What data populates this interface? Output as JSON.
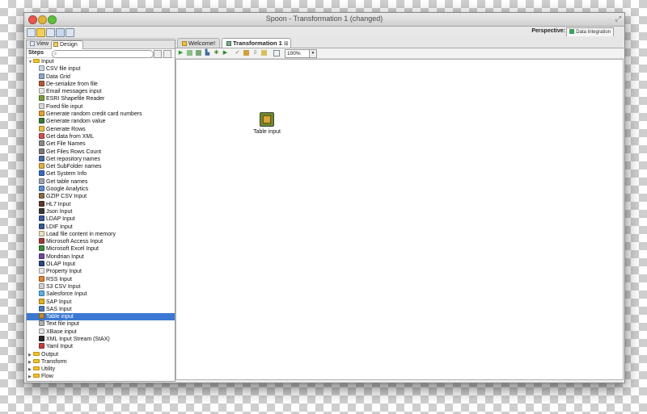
{
  "window": {
    "title": "Spoon - Transformation 1 (changed)"
  },
  "perspective": {
    "label": "Perspective:",
    "value": "Data Integration"
  },
  "left_panel": {
    "tabs": [
      "View",
      "Design"
    ],
    "steps_label": "Steps",
    "search_placeholder": "",
    "categories": [
      {
        "label": "Input",
        "expanded": true,
        "items": [
          {
            "label": "CSV file input",
            "color": "#c9d6e4"
          },
          {
            "label": "Data Grid",
            "color": "#8aa6c2"
          },
          {
            "label": "De-serialize from file",
            "color": "#b05a3a"
          },
          {
            "label": "Email messages input",
            "color": "#e8e8e8"
          },
          {
            "label": "ESRI Shapefile Reader",
            "color": "#7a9c3a"
          },
          {
            "label": "Fixed file input",
            "color": "#d8d8d8"
          },
          {
            "label": "Generate random credit card numbers",
            "color": "#e0a030"
          },
          {
            "label": "Generate random value",
            "color": "#3a7a3a"
          },
          {
            "label": "Generate Rows",
            "color": "#e6c040"
          },
          {
            "label": "Get data from XML",
            "color": "#d05050"
          },
          {
            "label": "Get File Names",
            "color": "#8a8a8a"
          },
          {
            "label": "Get Files Rows Count",
            "color": "#7a7a7a"
          },
          {
            "label": "Get repository names",
            "color": "#4a6aa0"
          },
          {
            "label": "Get SubFolder names",
            "color": "#e0b040"
          },
          {
            "label": "Get System Info",
            "color": "#3a6ac0"
          },
          {
            "label": "Get table names",
            "color": "#9aa4b0"
          },
          {
            "label": "Google Analytics",
            "color": "#5a8ad0"
          },
          {
            "label": "GZIP CSV Input",
            "color": "#8a6a4a"
          },
          {
            "label": "HL7 Input",
            "color": "#5a3a2a"
          },
          {
            "label": "Json Input",
            "color": "#3a3a3a"
          },
          {
            "label": "LDAP Input",
            "color": "#3a5aa0"
          },
          {
            "label": "LDIF Input",
            "color": "#3a5a90"
          },
          {
            "label": "Load file content in memory",
            "color": "#e8e0c0"
          },
          {
            "label": "Microsoft Access Input",
            "color": "#a03a3a"
          },
          {
            "label": "Microsoft Excel Input",
            "color": "#3a8a3a"
          },
          {
            "label": "Mondrian Input",
            "color": "#6a4aa0"
          },
          {
            "label": "OLAP Input",
            "color": "#2a4a7a"
          },
          {
            "label": "Property Input",
            "color": "#e8e8e8"
          },
          {
            "label": "RSS Input",
            "color": "#e08030"
          },
          {
            "label": "S3 CSV Input",
            "color": "#d0d0d0"
          },
          {
            "label": "Salesforce Input",
            "color": "#5ab0e0"
          },
          {
            "label": "SAP Input",
            "color": "#e0b020"
          },
          {
            "label": "SAS Input",
            "color": "#4a7ac0"
          },
          {
            "label": "Table input",
            "color": "#c08a30",
            "selected": true
          },
          {
            "label": "Text file input",
            "color": "#b0b0b0"
          },
          {
            "label": "XBase input",
            "color": "#e0e0e0"
          },
          {
            "label": "XML Input Stream (StAX)",
            "color": "#2a2a2a"
          },
          {
            "label": "Yaml Input",
            "color": "#c04040"
          }
        ]
      },
      {
        "label": "Output",
        "expanded": false
      },
      {
        "label": "Transform",
        "expanded": false
      },
      {
        "label": "Utility",
        "expanded": false
      },
      {
        "label": "Flow",
        "expanded": false
      }
    ]
  },
  "editor": {
    "tabs": [
      {
        "label": "Welcome!",
        "active": false
      },
      {
        "label": "Transformation 1",
        "active": true,
        "close": "⊠"
      }
    ],
    "zoom": "100%",
    "canvas_steps": [
      {
        "label": "Table input",
        "icon": "table-input-icon"
      }
    ]
  }
}
